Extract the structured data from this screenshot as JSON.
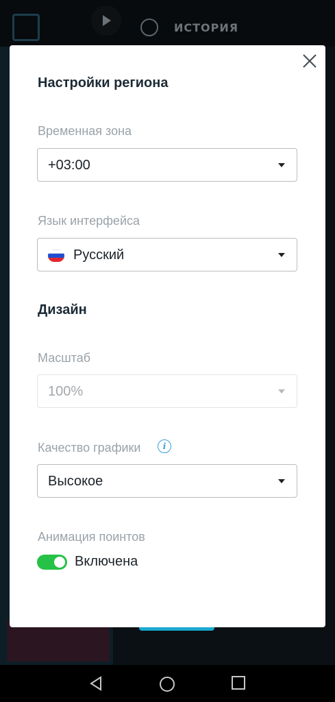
{
  "background": {
    "tab_label": "ИСТОРИЯ"
  },
  "modal": {
    "region_title": "Настройки региона",
    "timezone": {
      "label": "Временная зона",
      "value": "+03:00"
    },
    "language": {
      "label": "Язык интерфейса",
      "value": "Русский",
      "flag_colors": [
        "#ffffff",
        "#1f4fd1",
        "#e3262e"
      ]
    },
    "design_title": "Дизайн",
    "scale": {
      "label": "Масштаб",
      "value": "100%",
      "disabled": true
    },
    "graphics": {
      "label": "Качество графики",
      "value": "Высокое",
      "info_glyph": "i"
    },
    "animation": {
      "label": "Анимация поинтов",
      "state_label": "Включена",
      "enabled": true
    }
  },
  "colors": {
    "toggle_on": "#25c247",
    "info_accent": "#3aa0d8"
  },
  "icons": [
    "close-icon",
    "chevron-down-icon",
    "russia-flag-icon",
    "info-icon",
    "back-icon",
    "home-icon",
    "recents-icon",
    "play-icon",
    "clock-icon"
  ]
}
